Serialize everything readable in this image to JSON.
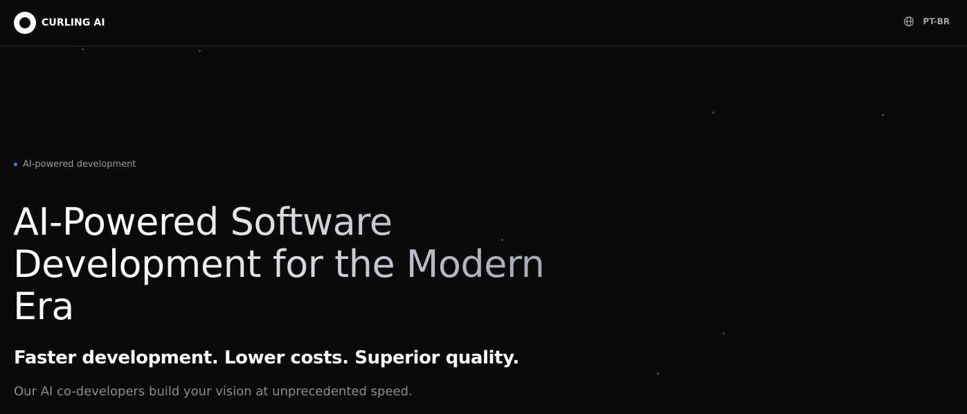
{
  "brand": {
    "name": "CURLING AI"
  },
  "header": {
    "language_label": "PT-BR",
    "language_icon": "globe-icon"
  },
  "hero": {
    "eyebrow": "AI-powered development",
    "headline": "AI-Powered Software Development for the Modern Era",
    "subheadline": "Faster development. Lower costs. Superior quality.",
    "description": "Our AI co-developers build your vision at unprecedented speed."
  },
  "colors": {
    "background": "#0a0a0b",
    "accent": "#3b82f6",
    "text_primary": "#ffffff",
    "text_muted": "#8b8b92"
  }
}
